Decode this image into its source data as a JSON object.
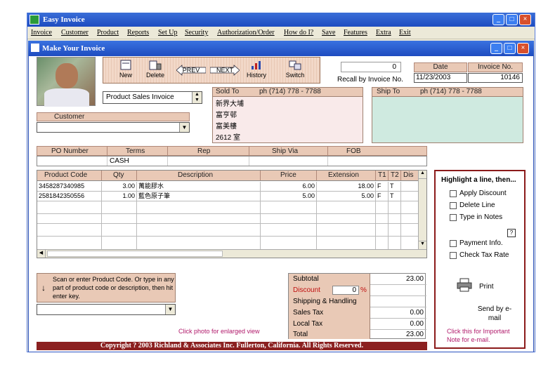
{
  "window": {
    "title": "Easy Invoice"
  },
  "menu": [
    "Invoice",
    "Customer",
    "Product",
    "Reports",
    "Set Up",
    "Security",
    "Authorization/Order",
    "How do I?",
    "Save",
    "Features",
    "Extra",
    "Exit"
  ],
  "dialog": {
    "title": "Make Your Invoice"
  },
  "toolbar": {
    "new": "New",
    "delete": "Delete",
    "prev": "PREV",
    "next": "NEXT",
    "history": "History",
    "switch": "Switch"
  },
  "recall": {
    "value": "0",
    "label": "Recall by Invoice No."
  },
  "date": {
    "label": "Date",
    "value": "11/23/2003"
  },
  "invoice_no": {
    "label": "Invoice No.",
    "value": "10146"
  },
  "invoice_type": "Product Sales Invoice",
  "customer": {
    "label": "Customer",
    "value": ""
  },
  "sold_to": {
    "label": "Sold To",
    "phone": "ph (714) 778 - 7788",
    "lines": [
      "新界大埔",
      "富亨邨",
      "富美樓",
      "2612 室"
    ]
  },
  "ship_to": {
    "label": "Ship To",
    "phone": "ph (714) 778 - 7788"
  },
  "order": {
    "headers": [
      "PO Number",
      "Terms",
      "Rep",
      "Ship Via",
      "FOB"
    ],
    "values": [
      "",
      "CASH",
      "",
      "",
      ""
    ]
  },
  "grid": {
    "headers": [
      "Product Code",
      "Qty",
      "Description",
      "Price",
      "Extension",
      "T1",
      "T2",
      "Dis"
    ],
    "rows": [
      [
        "3458287340985",
        "3.00",
        "萬能膠水",
        "6.00",
        "18.00",
        "F",
        "T",
        ""
      ],
      [
        "2581842350556",
        "1.00",
        "藍色原子筆",
        "5.00",
        "5.00",
        "F",
        "T",
        ""
      ]
    ]
  },
  "side": {
    "title": "Highlight a line, then...",
    "options": [
      "Apply Discount",
      "Delete Line",
      "Type in Notes"
    ],
    "options2": [
      "Payment Info.",
      "Check Tax Rate"
    ],
    "print": "Print",
    "email": "Send by e-mail",
    "note": "Click this for Important Note for e-mail."
  },
  "scan": {
    "text": "Scan or enter Product Code. Or type in any part of product code or description, then hit enter key."
  },
  "photo_hint": "Click photo for enlarged view",
  "totals": {
    "subtotal_label": "Subtotal",
    "subtotal": "23.00",
    "discount_label": "Discount",
    "discount": "0",
    "pct": "%",
    "shipping_label": "Shipping & Handling",
    "shipping": "",
    "tax_label": "Sales Tax",
    "tax": "0.00",
    "local_label": "Local Tax",
    "local": "0.00",
    "total_label": "Total",
    "total": "23.00"
  },
  "footer": "Copyright ? 2003 Richland & Associates Inc. Fullerton, California. All Rights Reserved."
}
